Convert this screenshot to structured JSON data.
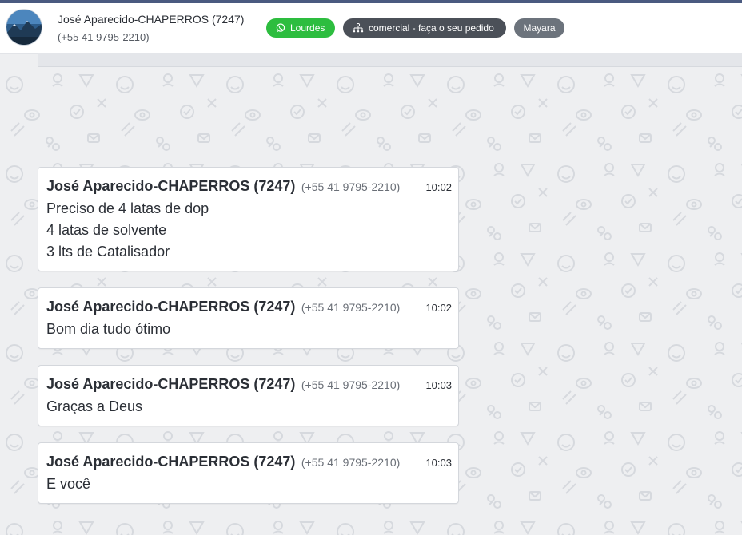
{
  "header": {
    "contact_name": "José Aparecido-CHAPERROS (7247)",
    "contact_phone": "(+55 41 9795-2210)",
    "tags": [
      {
        "label": "Lourdes",
        "icon": "whatsapp-icon",
        "color": "#2dbd3f"
      },
      {
        "label": "comercial - faça o seu pedido",
        "icon": "sitemap-icon",
        "color": "#4b5058"
      },
      {
        "label": "Mayara",
        "icon": "",
        "color": "#6c737c"
      }
    ]
  },
  "messages": [
    {
      "sender": "José Aparecido-CHAPERROS (7247)",
      "phone": "(+55 41 9795-2210)",
      "time": "10:02",
      "lines": [
        "Preciso de 4 latas de dop",
        "4 latas de solvente",
        "3 lts de Catalisador"
      ]
    },
    {
      "sender": "José Aparecido-CHAPERROS (7247)",
      "phone": "(+55 41 9795-2210)",
      "time": "10:02",
      "lines": [
        "Bom dia tudo ótimo"
      ]
    },
    {
      "sender": "José Aparecido-CHAPERROS (7247)",
      "phone": "(+55 41 9795-2210)",
      "time": "10:03",
      "lines": [
        "Graças a Deus"
      ]
    },
    {
      "sender": "José Aparecido-CHAPERROS (7247)",
      "phone": "(+55 41 9795-2210)",
      "time": "10:03",
      "lines": [
        "E você"
      ]
    }
  ]
}
